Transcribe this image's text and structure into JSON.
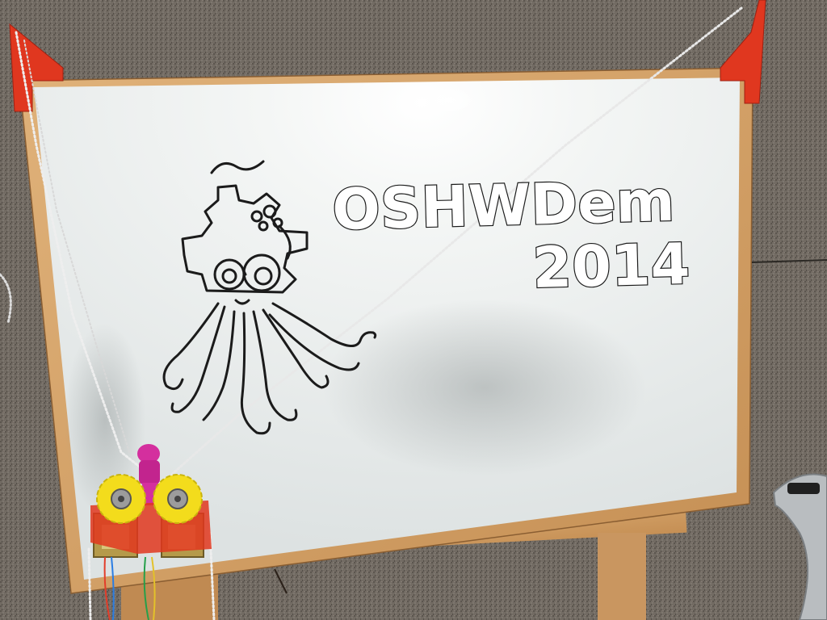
{
  "scene": {
    "description_tag": "whiteboard-plotter",
    "whiteboard": {
      "text_line_1": "OSHWDem",
      "text_line_2": "2014"
    },
    "colors": {
      "wall": "#6e6860",
      "frame_wood": "#d6a46c",
      "board": "#eef1f0",
      "ink": "#1b1b1b",
      "gear_yellow": "#f3dc1c",
      "mount_red": "#e0371f",
      "figure_magenta": "#d42f9e"
    }
  }
}
